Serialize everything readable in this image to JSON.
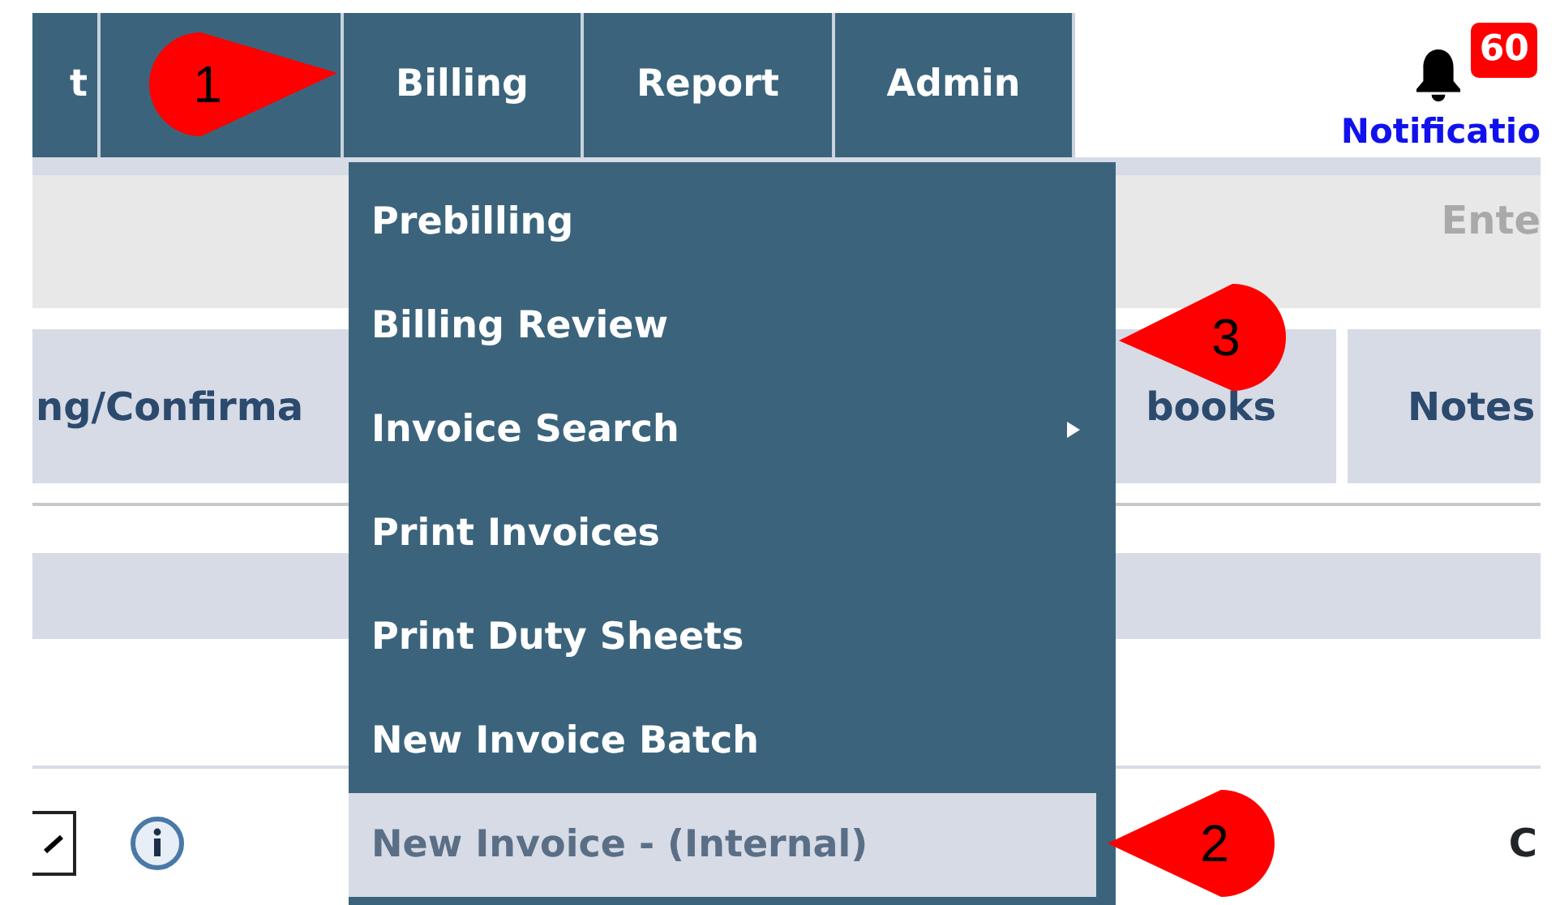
{
  "nav": {
    "items": [
      {
        "kind": "tab",
        "label": "t"
      },
      {
        "kind": "covered"
      },
      {
        "kind": "tab",
        "label": "Billing"
      },
      {
        "kind": "tab",
        "label": "Report"
      },
      {
        "kind": "tab",
        "label": "Admin"
      }
    ]
  },
  "notifications": {
    "count": "60",
    "label": "Notificatio"
  },
  "search": {
    "placeholder": "Ente"
  },
  "tabs": [
    {
      "label": "ng/Confirma"
    },
    {
      "label": "books"
    },
    {
      "label": "Notes"
    }
  ],
  "row": {
    "checked": true,
    "trailing": "C"
  },
  "menu": {
    "items": [
      {
        "label": "Prebilling",
        "selected": false,
        "submenu": false
      },
      {
        "label": "Billing Review",
        "selected": false,
        "submenu": false
      },
      {
        "label": "Invoice Search",
        "selected": false,
        "submenu": true
      },
      {
        "label": "Print Invoices",
        "selected": false,
        "submenu": false
      },
      {
        "label": "Print Duty Sheets",
        "selected": false,
        "submenu": false
      },
      {
        "label": "New Invoice Batch",
        "selected": false,
        "submenu": false
      },
      {
        "label": "New Invoice - (Internal)",
        "selected": true,
        "submenu": false
      }
    ]
  },
  "callouts": [
    {
      "number": "1"
    },
    {
      "number": "3"
    },
    {
      "number": "2"
    }
  ]
}
